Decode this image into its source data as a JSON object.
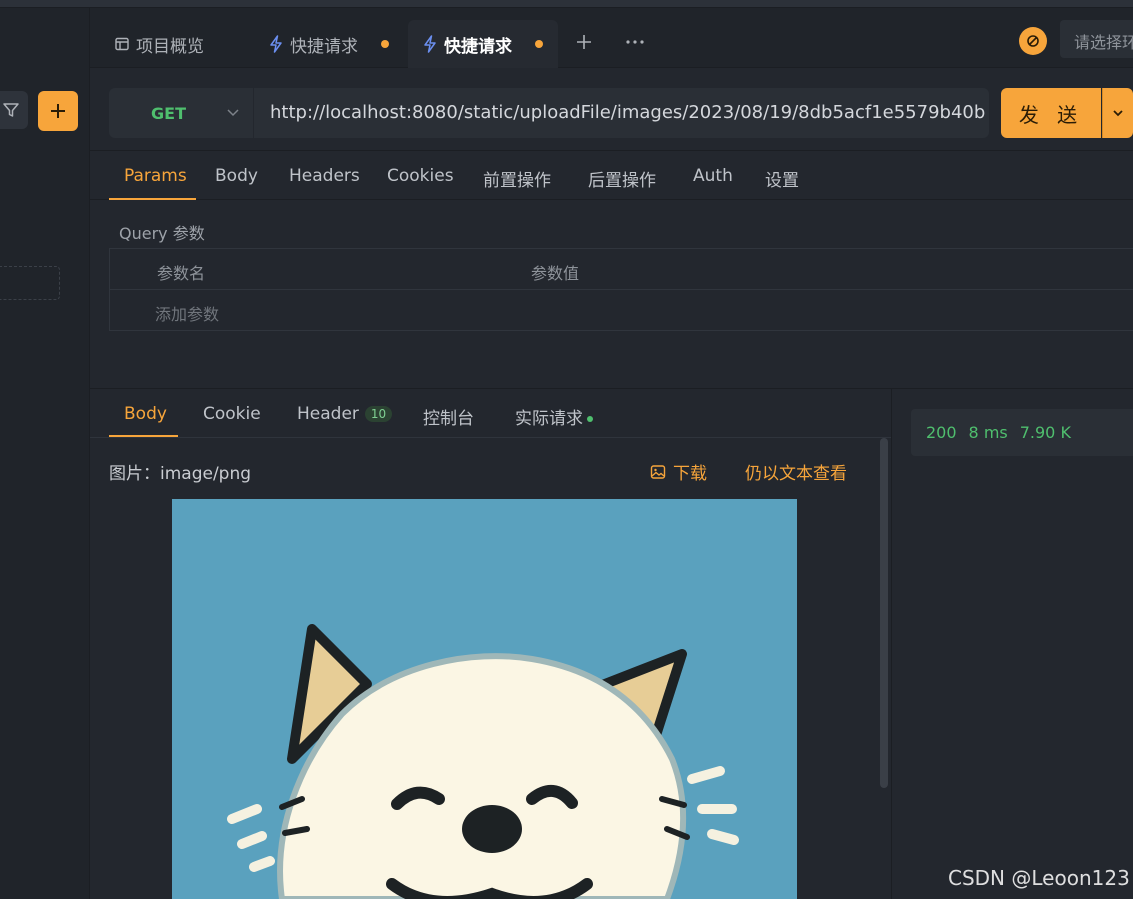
{
  "tabs": [
    {
      "label": "项目概览",
      "icon": "overview-icon"
    },
    {
      "label": "快捷请求",
      "icon": "lightning-icon",
      "unsaved": true
    },
    {
      "label": "快捷请求",
      "icon": "lightning-icon",
      "unsaved": true,
      "active": true
    }
  ],
  "env": {
    "placeholder": "请选择环境"
  },
  "request": {
    "method": "GET",
    "url": "http://localhost:8080/static/uploadFile/images/2023/08/19/8db5acf1e5579b40b",
    "send_label": "发 送"
  },
  "request_tabs": [
    "Params",
    "Body",
    "Headers",
    "Cookies",
    "前置操作",
    "后置操作",
    "Auth",
    "设置"
  ],
  "params": {
    "title": "Query 参数",
    "col_name": "参数名",
    "col_value": "参数值",
    "add_placeholder": "添加参数"
  },
  "response": {
    "tabs": [
      "Body",
      "Cookie",
      "Header",
      "控制台",
      "实际请求"
    ],
    "header_count": "10",
    "image_label": "图片：image/png",
    "download_label": "下载",
    "view_as_text_label": "仍以文本查看",
    "status_code": "200",
    "time": "8 ms",
    "size": "7.90 K"
  },
  "watermark": "CSDN @Leoon123",
  "colors": {
    "accent": "#f7a53b",
    "success": "#4fbf6e",
    "background": "#23272e"
  }
}
